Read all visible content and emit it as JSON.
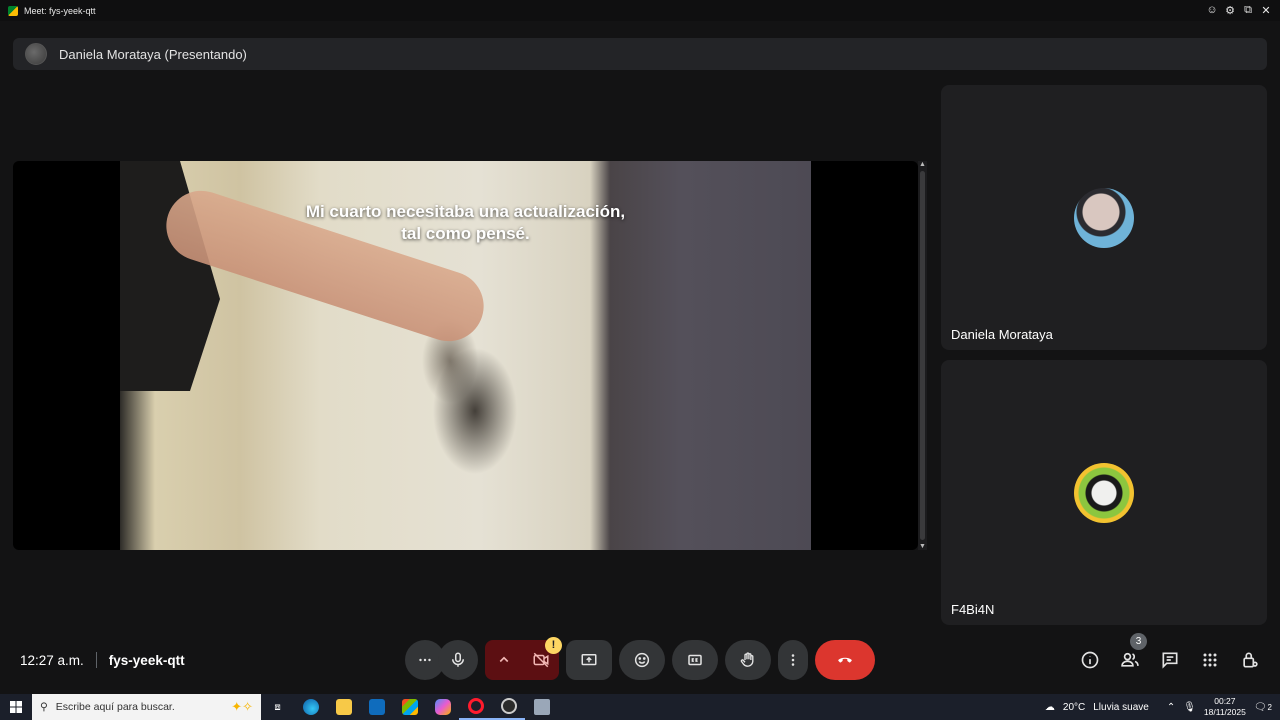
{
  "window": {
    "title": "Meet: fys-yeek-qtt",
    "controls": [
      "shield-icon",
      "gear-icon",
      "popout-icon",
      "close-icon"
    ]
  },
  "presenter": {
    "label": "Daniela Morataya (Presentando)"
  },
  "presentation": {
    "caption_line1": "Mi cuarto necesitaba una actualización,",
    "caption_line2": "tal como pensé."
  },
  "participants": [
    {
      "name": "Daniela Morataya"
    },
    {
      "name": "F4Bi4N"
    }
  ],
  "meeting": {
    "time": "12:27 a.m.",
    "code": "fys-yeek-qtt"
  },
  "controls": {
    "more_options": "more-horizontal-icon",
    "mic": "mic-icon",
    "camera_options": "chevron-up-icon",
    "camera": "camera-off-icon",
    "camera_warning": "!",
    "present": "present-screen-icon",
    "reactions": "emoji-icon",
    "captions": "captions-icon",
    "raise_hand": "hand-icon",
    "more": "more-vertical-icon",
    "hangup": "call-end-icon"
  },
  "right_controls": {
    "info": "info-icon",
    "people": "people-icon",
    "people_count": "3",
    "chat": "chat-icon",
    "activities": "apps-icon",
    "host_controls": "lock-person-icon"
  },
  "taskbar": {
    "search_placeholder": "Escribe aquí para buscar.",
    "weather_temp": "20°C",
    "weather_text": "Lluvia suave",
    "clock_time": "00:27",
    "clock_date": "18/11/2025",
    "notification_count": "2"
  },
  "colors": {
    "background": "#131314",
    "tile": "#1f1f21",
    "hangup": "#dc362e",
    "camera_off": "#5c0f12",
    "warning": "#fdd663"
  }
}
